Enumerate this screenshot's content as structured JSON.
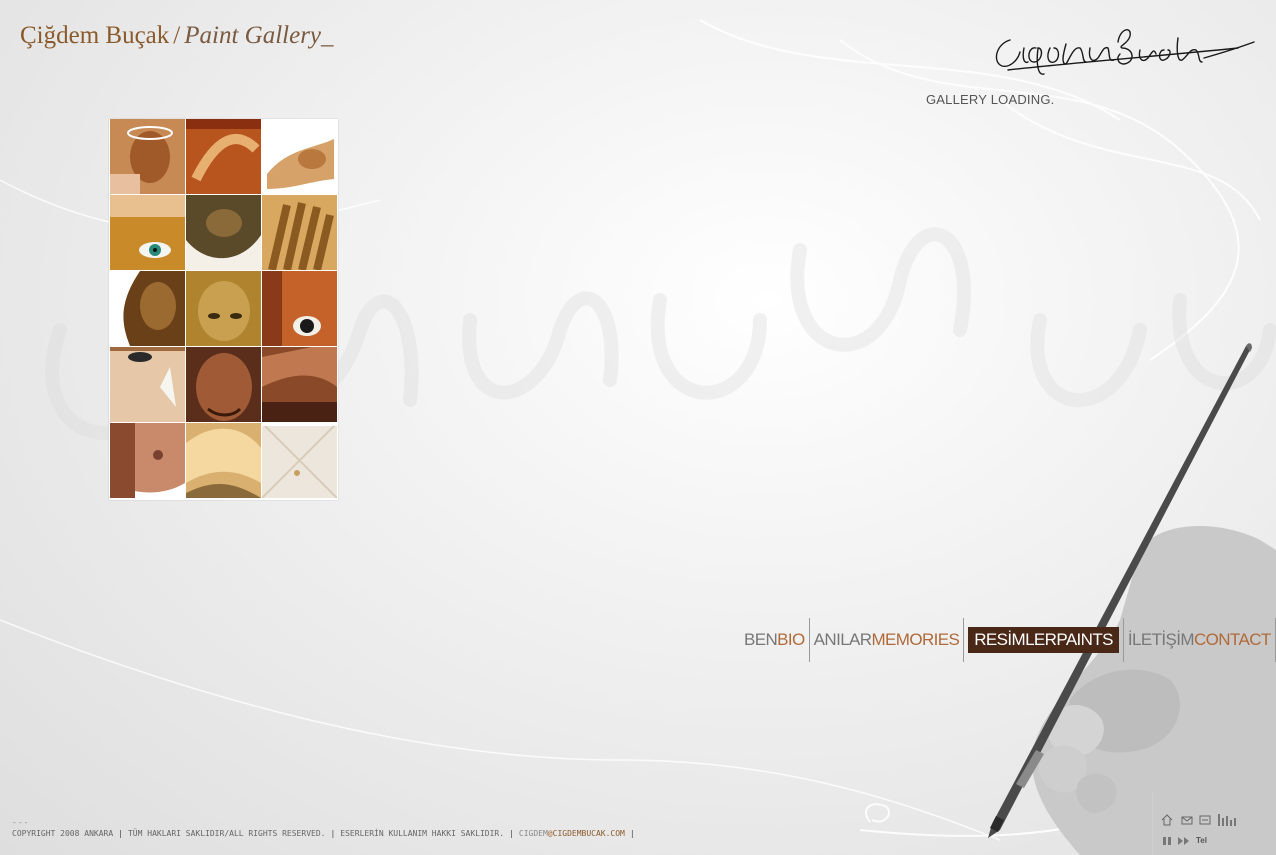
{
  "header": {
    "title": "Çiğdem Buçak",
    "separator": "/",
    "subtitle": "Paint Gallery_"
  },
  "status": {
    "loading_text": "GALLERY LOADING."
  },
  "gallery": {
    "thumbnails": [
      {
        "name": "thumb-1"
      },
      {
        "name": "thumb-2"
      },
      {
        "name": "thumb-3"
      },
      {
        "name": "thumb-4"
      },
      {
        "name": "thumb-5"
      },
      {
        "name": "thumb-6"
      },
      {
        "name": "thumb-7"
      },
      {
        "name": "thumb-8"
      },
      {
        "name": "thumb-9"
      },
      {
        "name": "thumb-10"
      },
      {
        "name": "thumb-11"
      },
      {
        "name": "thumb-12"
      },
      {
        "name": "thumb-13"
      },
      {
        "name": "thumb-14"
      },
      {
        "name": "thumb-15"
      }
    ]
  },
  "nav": {
    "items": [
      {
        "tr": "BEN",
        "en": "BIO",
        "active": false
      },
      {
        "tr": "ANILAR",
        "en": "MEMORIES",
        "active": false
      },
      {
        "tr": "RESİMLER",
        "en": "PAINTS",
        "active": true
      },
      {
        "tr": "İLETİŞİM",
        "en": "CONTACT",
        "active": false
      }
    ]
  },
  "footer": {
    "dash": "---",
    "copyright": "COPYRIGHT 2008 ANKARA",
    "rights": "TÜM HAKLARI SAKLIDIR/ALL RIGHTS RESERVED.",
    "usage": "ESERLERİN KULLANIM HAKKI SAKLIDIR.",
    "email_user": "CIGDEM",
    "email_at": "@",
    "email_domain": "CIGDEMBUCAK.COM",
    "bar": "|"
  },
  "controls": {
    "icons": [
      "home-icon",
      "mail-icon",
      "window-icon",
      "equalizer-icon",
      "pause-icon",
      "forward-icon"
    ],
    "tel_label": "Tel"
  },
  "colors": {
    "accent_brown": "#8a5a2b",
    "accent_orange": "#b06a3a",
    "active_bg": "#4a2818"
  }
}
